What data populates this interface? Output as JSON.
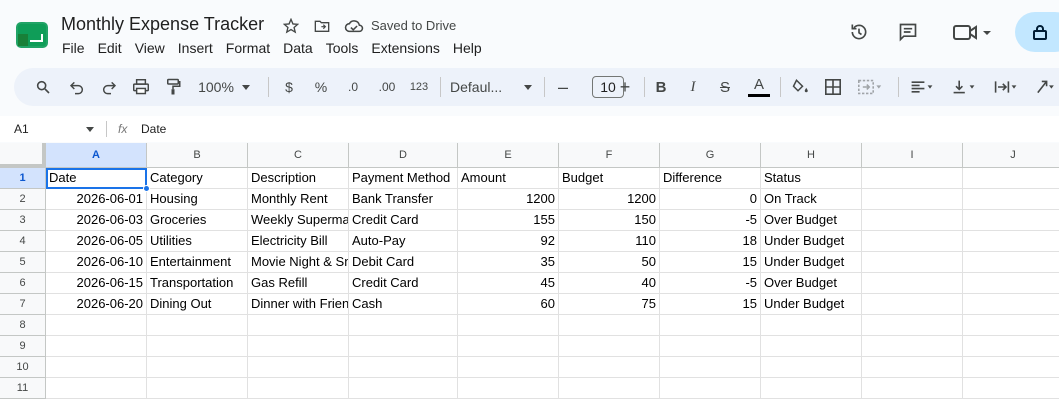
{
  "app": {
    "title": "Monthly Expense Tracker",
    "saved_status": "Saved to Drive",
    "accent": "#1a73e8"
  },
  "menu": [
    "File",
    "Edit",
    "View",
    "Insert",
    "Format",
    "Data",
    "Tools",
    "Extensions",
    "Help"
  ],
  "toolbar": {
    "zoom": "100%",
    "currency": "$",
    "percent": "%",
    "decrease_decimal": ".0",
    "increase_decimal": ".00",
    "number_format": "123",
    "font": "Defaul...",
    "font_size": "10"
  },
  "formula_bar": {
    "cell_ref": "A1",
    "fx": "fx",
    "value": "Date"
  },
  "columns": [
    "A",
    "B",
    "C",
    "D",
    "E",
    "F",
    "G",
    "H",
    "I",
    "J"
  ],
  "rows": [
    "1",
    "2",
    "3",
    "4",
    "5",
    "6",
    "7",
    "8",
    "9",
    "10",
    "11"
  ],
  "sheet": {
    "headers": [
      "Date",
      "Category",
      "Description",
      "Payment Method",
      "Amount",
      "Budget",
      "Difference",
      "Status"
    ],
    "data": [
      [
        "2026-06-01",
        "Housing",
        "Monthly Rent",
        "Bank Transfer",
        "1200",
        "1200",
        "0",
        "On Track"
      ],
      [
        "2026-06-03",
        "Groceries",
        "Weekly Supermarket",
        "Credit Card",
        "155",
        "150",
        "-5",
        "Over Budget"
      ],
      [
        "2026-06-05",
        "Utilities",
        "Electricity Bill",
        "Auto-Pay",
        "92",
        "110",
        "18",
        "Under Budget"
      ],
      [
        "2026-06-10",
        "Entertainment",
        "Movie Night & Snacks",
        "Debit Card",
        "35",
        "50",
        "15",
        "Under Budget"
      ],
      [
        "2026-06-15",
        "Transportation",
        "Gas Refill",
        "Credit Card",
        "45",
        "40",
        "-5",
        "Over Budget"
      ],
      [
        "2026-06-20",
        "Dining Out",
        "Dinner with Friends",
        "Cash",
        "60",
        "75",
        "15",
        "Under Budget"
      ]
    ]
  }
}
